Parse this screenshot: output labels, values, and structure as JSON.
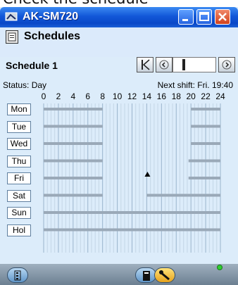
{
  "caption": "Check the schedule",
  "window": {
    "title": "AK-SM720"
  },
  "panel": {
    "title": "Schedules",
    "schedule_name": "Schedule 1"
  },
  "status": {
    "label": "Status: Day",
    "next_shift": "Next shift: Fri. 19:40"
  },
  "hours": [
    "0",
    "2",
    "4",
    "6",
    "8",
    "10",
    "12",
    "14",
    "16",
    "18",
    "20",
    "22",
    "24"
  ],
  "days": [
    {
      "key": "mon",
      "label": "Mon",
      "periods": [
        [
          0,
          8
        ],
        [
          20,
          24
        ]
      ]
    },
    {
      "key": "tue",
      "label": "Tue",
      "periods": [
        [
          0,
          8
        ],
        [
          20,
          24
        ]
      ]
    },
    {
      "key": "wed",
      "label": "Wed",
      "periods": [
        [
          0,
          8
        ],
        [
          20,
          24
        ]
      ]
    },
    {
      "key": "thu",
      "label": "Thu",
      "periods": [
        [
          0,
          8
        ],
        [
          19.67,
          24
        ]
      ]
    },
    {
      "key": "fri",
      "label": "Fri",
      "periods": [
        [
          0,
          8
        ],
        [
          19.67,
          24
        ]
      ]
    },
    {
      "key": "sat",
      "label": "Sat",
      "periods": [
        [
          0,
          8
        ],
        [
          14,
          24
        ]
      ]
    },
    {
      "key": "sun",
      "label": "Sun",
      "periods": [
        [
          0,
          24
        ]
      ]
    },
    {
      "key": "hol",
      "label": "Hol",
      "periods": [
        [
          0,
          24
        ]
      ]
    }
  ],
  "current_time_marker": {
    "day": "fri",
    "hour": 14
  },
  "icons": {
    "app": "network-card-icon",
    "schedule": "calendar-icon",
    "first": "skip-first-icon",
    "prev": "step-back-icon",
    "next": "step-forward-icon",
    "tree": "tree-view-icon",
    "alarm": "alarm-icon",
    "service": "wrench-icon"
  },
  "colors": {
    "title_bar": "#0a48c8",
    "close_button": "#d2421c",
    "led": "#2fcf2f"
  }
}
